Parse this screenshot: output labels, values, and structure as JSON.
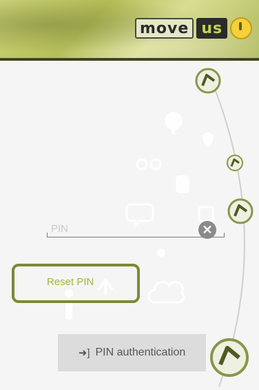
{
  "brand": {
    "logo_move": "move",
    "logo_us": "us"
  },
  "form": {
    "pin_placeholder": "PIN",
    "clear_icon": "close-circle-icon",
    "reset_label": "Reset PIN"
  },
  "actions": {
    "auth_label": "PIN authentication",
    "auth_icon": "login-arrow-icon"
  },
  "colors": {
    "accent": "#9fb83a",
    "highlight_border": "#7a8a35",
    "header_line": "#3f4426"
  }
}
